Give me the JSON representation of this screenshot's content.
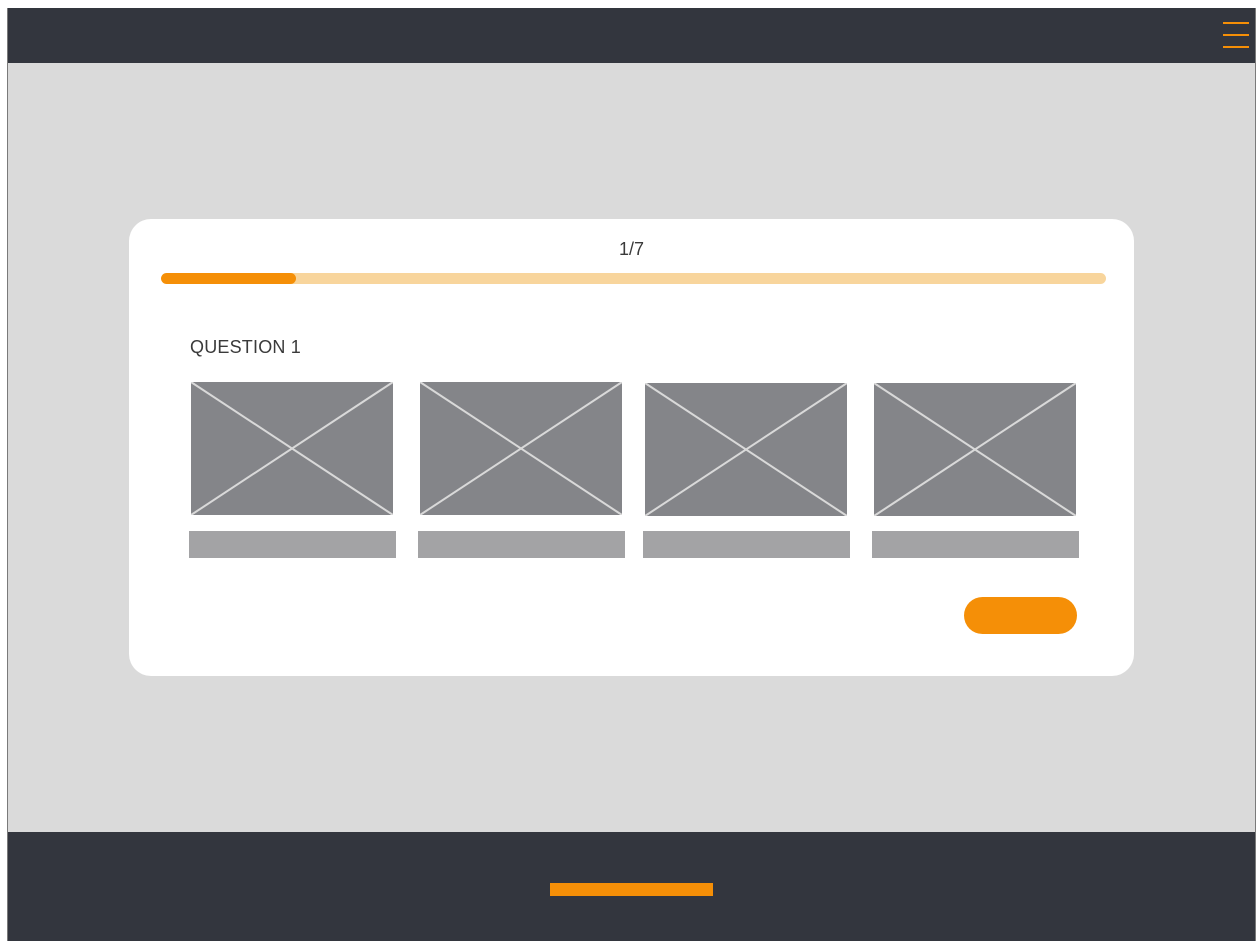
{
  "header": {
    "menu_icon": "hamburger-menu-icon",
    "accent_color": "#f58f07",
    "background_color": "#33363e"
  },
  "quiz": {
    "progress_text": "1/7",
    "progress": {
      "current": 1,
      "total": 7,
      "fraction": 0.143
    },
    "question_label": "QUESTION 1",
    "options": [
      {
        "image_icon": "image-placeholder-icon",
        "label": ""
      },
      {
        "image_icon": "image-placeholder-icon",
        "label": ""
      },
      {
        "image_icon": "image-placeholder-icon",
        "label": ""
      },
      {
        "image_icon": "image-placeholder-icon",
        "label": ""
      }
    ],
    "submit_label": ""
  },
  "footer": {
    "background_color": "#33363e",
    "accent_color": "#f58f07"
  }
}
